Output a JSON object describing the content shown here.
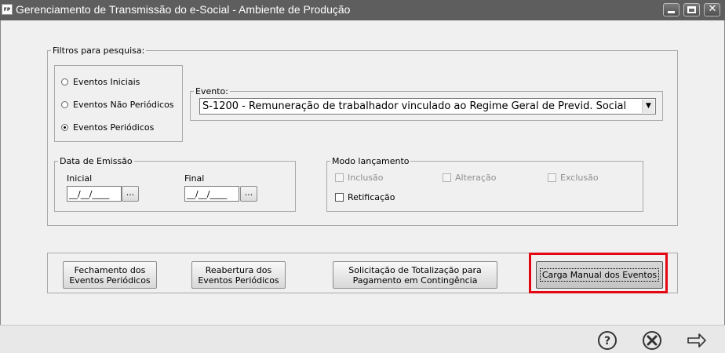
{
  "window": {
    "app_icon": "FP",
    "title": "Gerenciamento de Transmissão do e-Social - Ambiente de Produção",
    "controls": [
      "minimize-icon",
      "maximize-icon",
      "close-icon"
    ]
  },
  "filters": {
    "legend": "Filtros para pesquisa:",
    "radios": [
      {
        "label": "Eventos Iniciais",
        "checked": false
      },
      {
        "label": "Eventos Não Periódicos",
        "checked": false
      },
      {
        "label": "Eventos Periódicos",
        "checked": true
      }
    ],
    "evento": {
      "legend": "Evento:",
      "value": "S-1200 - Remuneração de trabalhador vinculado ao Regime Geral de Previd. Social"
    },
    "data_emissao": {
      "legend": "Data de Emissão",
      "inicial_label": "Inicial",
      "inicial_value": "__/__/____",
      "final_label": "Final",
      "final_value": "__/__/____",
      "picker_label": "..."
    },
    "modo": {
      "legend": "Modo lançamento",
      "inclusao": {
        "label": "Inclusão",
        "checked": false,
        "enabled": false
      },
      "alteracao": {
        "label": "Alteração",
        "checked": false,
        "enabled": false
      },
      "exclusao": {
        "label": "Exclusão",
        "checked": false,
        "enabled": false
      },
      "retificacao": {
        "label": "Retificação",
        "checked": false,
        "enabled": true
      }
    }
  },
  "actions": {
    "fechamento": "Fechamento dos Eventos Periódicos",
    "reabertura": "Reabertura dos Eventos Periódicos",
    "solicitacao": "Solicitação de Totalização para Pagamento em Contingência",
    "carga_manual": "Carga Manual dos Eventos"
  },
  "highlight_color": "#e30613",
  "footer": {
    "icons": [
      "help-icon",
      "cancel-icon",
      "next-arrow-icon"
    ]
  }
}
